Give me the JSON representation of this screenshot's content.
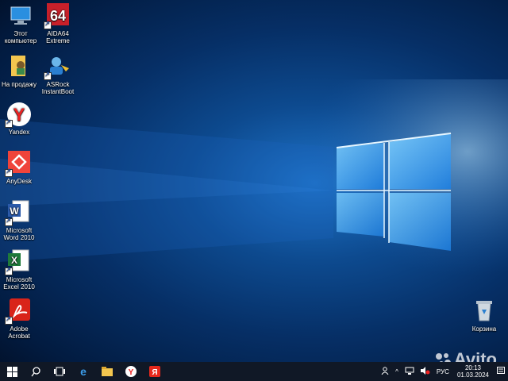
{
  "desktop": {
    "icons": [
      {
        "label": "Этот\nкомпьютер"
      },
      {
        "label": "AIDA64\nExtreme"
      },
      {
        "label": "На продажу"
      },
      {
        "label": "ASRock\nInstantBoot"
      },
      {
        "label": "Yandex"
      },
      {
        "label": "AnyDesk"
      },
      {
        "label": "Microsoft\nWord 2010"
      },
      {
        "label": "Microsoft\nExcel 2010"
      },
      {
        "label": "Adobe\nAcrobat"
      },
      {
        "label": "Корзина"
      }
    ]
  },
  "taskbar": {
    "buttons": [
      "windows-start-icon",
      "search-icon",
      "task-view-icon",
      "edge-icon",
      "file-explorer-icon",
      "yandex-browser-icon",
      "yandex-icon"
    ],
    "tray": {
      "language": "РУС",
      "time": "20:13",
      "date": "01.03.2024"
    }
  },
  "watermark": {
    "text": "Avito"
  },
  "colors": {
    "taskbar": "#101826",
    "accent": "#1f74c9"
  }
}
